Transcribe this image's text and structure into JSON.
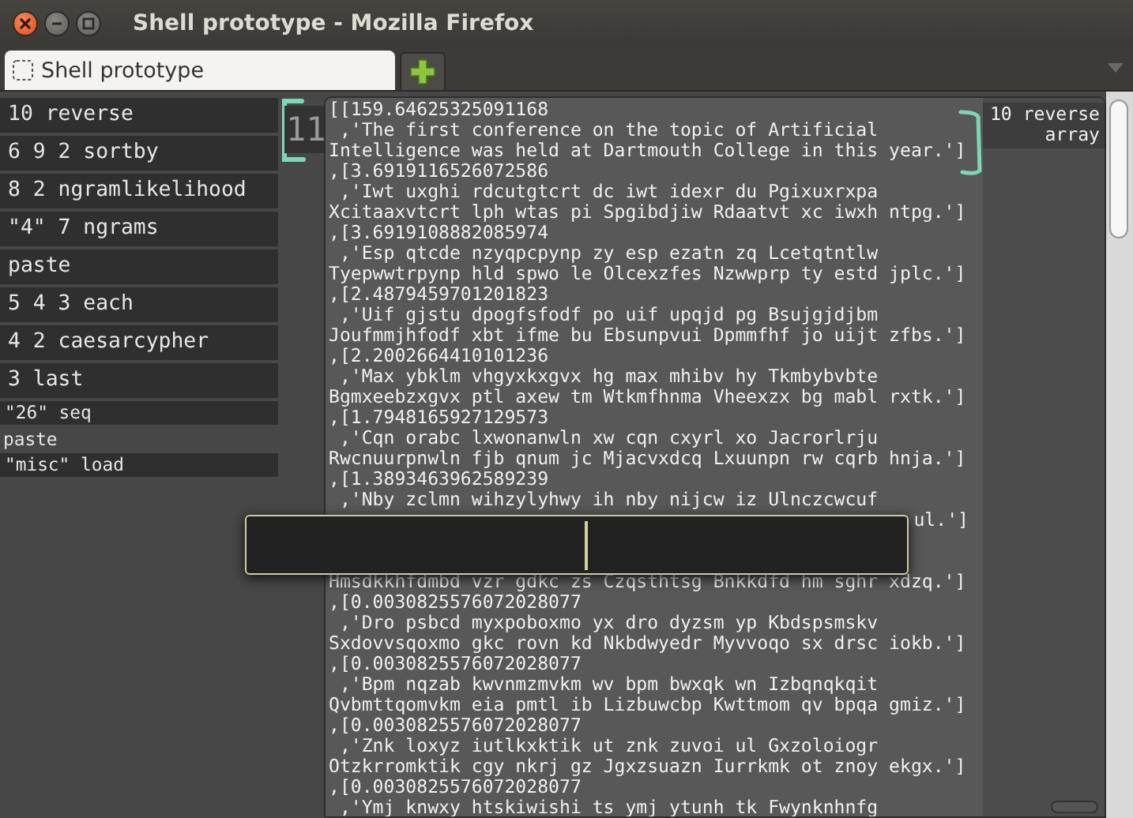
{
  "window": {
    "title": "Shell prototype - Mozilla Firefox"
  },
  "tabs": [
    {
      "label": "Shell prototype",
      "selected": true
    }
  ],
  "stack": {
    "items": [
      {
        "text": "10 reverse",
        "kind": "large"
      },
      {
        "text": "6 9 2 sortby",
        "kind": "large"
      },
      {
        "text": "8 2 ngramlikelihood",
        "kind": "large"
      },
      {
        "text": "\"4\" 7 ngrams",
        "kind": "large"
      },
      {
        "text": "paste",
        "kind": "large"
      },
      {
        "text": "5 4 3 each",
        "kind": "large"
      },
      {
        "text": "4 2 caesarcypher",
        "kind": "large"
      },
      {
        "text": "3 last",
        "kind": "large"
      },
      {
        "text": "\"26\" seq",
        "kind": "small"
      },
      {
        "text": "paste",
        "kind": "plain"
      },
      {
        "text": "\"misc\" load",
        "kind": "small"
      }
    ]
  },
  "counter": "11",
  "output": {
    "lines": [
      {
        "text": "[[159.64625325091168"
      },
      {
        "text": " ,'The first conference on the topic of Artificial"
      },
      {
        "text": "Intelligence was held at Dartmouth College in this year.']"
      },
      {
        "text": ",[3.6919116526072586"
      },
      {
        "text": " ,'Iwt uxghi rdcutgtcrt dc iwt idexr du Pgixuxrxpa"
      },
      {
        "text": "Xcitaaxvtcrt lph wtas pi Spgibdjiw Rdaatvt xc iwxh ntpg.']"
      },
      {
        "text": ",[3.6919108882085974"
      },
      {
        "text": " ,'Esp qtcde nzyqpcpynp zy esp ezatn zq Lcetqtntlw"
      },
      {
        "text": "Tyepwwtrpynp hld spwo le Olcexzfes Nzwwprp ty estd jplc.']"
      },
      {
        "text": ",[2.4879459701201823"
      },
      {
        "text": " ,'Uif gjstu dpogfsfodf po uif upqjd pg Bsujgjdjbm"
      },
      {
        "text": "Joufmmjhfodf xbt ifme bu Ebsunpvui Dpmmfhf jo uijt zfbs.']"
      },
      {
        "text": ",[2.2002664410101236"
      },
      {
        "text": " ,'Max ybklm vhgyxkxgvx hg max mhibv hy Tkmbybvbte"
      },
      {
        "text": "Bgmxeebzxgvx ptl axew tm Wtkmfhnma Vheexzx bg mabl rxtk.']"
      },
      {
        "text": ",[1.7948165927129573"
      },
      {
        "text": " ,'Cqn orabc lxwonanwln xw cqn cxyrl xo Jacrorlrju"
      },
      {
        "text": "Rwcnuurpnwln fjb qnum jc Mjacvxdcq Lxuunpn rw cqrb hnja.']"
      },
      {
        "text": ",[1.3893463962589239"
      },
      {
        "text": " ,'Nby zclmn wihzylyhwy ih nby nijcw iz Ulnczcwcuf"
      },
      {
        "text": "ul.']",
        "kind": "tail"
      },
      {
        "text": "Hmsdkkhfdmbd vzr gdkc zs Czqsthtsg Bnkkdfd hm sghr xdzq.']",
        "kind": "after_gap"
      },
      {
        "text": ",[0.0030825576072028077"
      },
      {
        "text": " ,'Dro psbcd myxpoboxmo yx dro dyzsm yp Kbdspsmskv"
      },
      {
        "text": "Sxdovvsqoxmo gkc rovn kd Nkbdwyedr Myvvoqo sx drsc iokb.']"
      },
      {
        "text": ",[0.0030825576072028077"
      },
      {
        "text": " ,'Bpm nqzab kwvnmzmvkm wv bpm bwxqk wn Izbqnqkqit"
      },
      {
        "text": "Qvbmttqomvkm eia pmtl ib Lizbuwcbp Kwttmom qv bpqa gmiz.']"
      },
      {
        "text": ",[0.0030825576072028077"
      },
      {
        "text": " ,'Znk loxyz iutlkxktik ut znk zuvoi ul Gxzoloiogr"
      },
      {
        "text": "Otzkrromktik cgy nkrj gz Jgxzsuazn Iurrkmk ot znoy ekgx.']"
      },
      {
        "text": ",[0.0030825576072028077"
      },
      {
        "text": " ,'Ymj knwxy htskiwishi ts ymj ytunh tk Fwynknhnfg"
      }
    ]
  },
  "annotation": {
    "lines": [
      "10 reverse",
      "array"
    ]
  }
}
